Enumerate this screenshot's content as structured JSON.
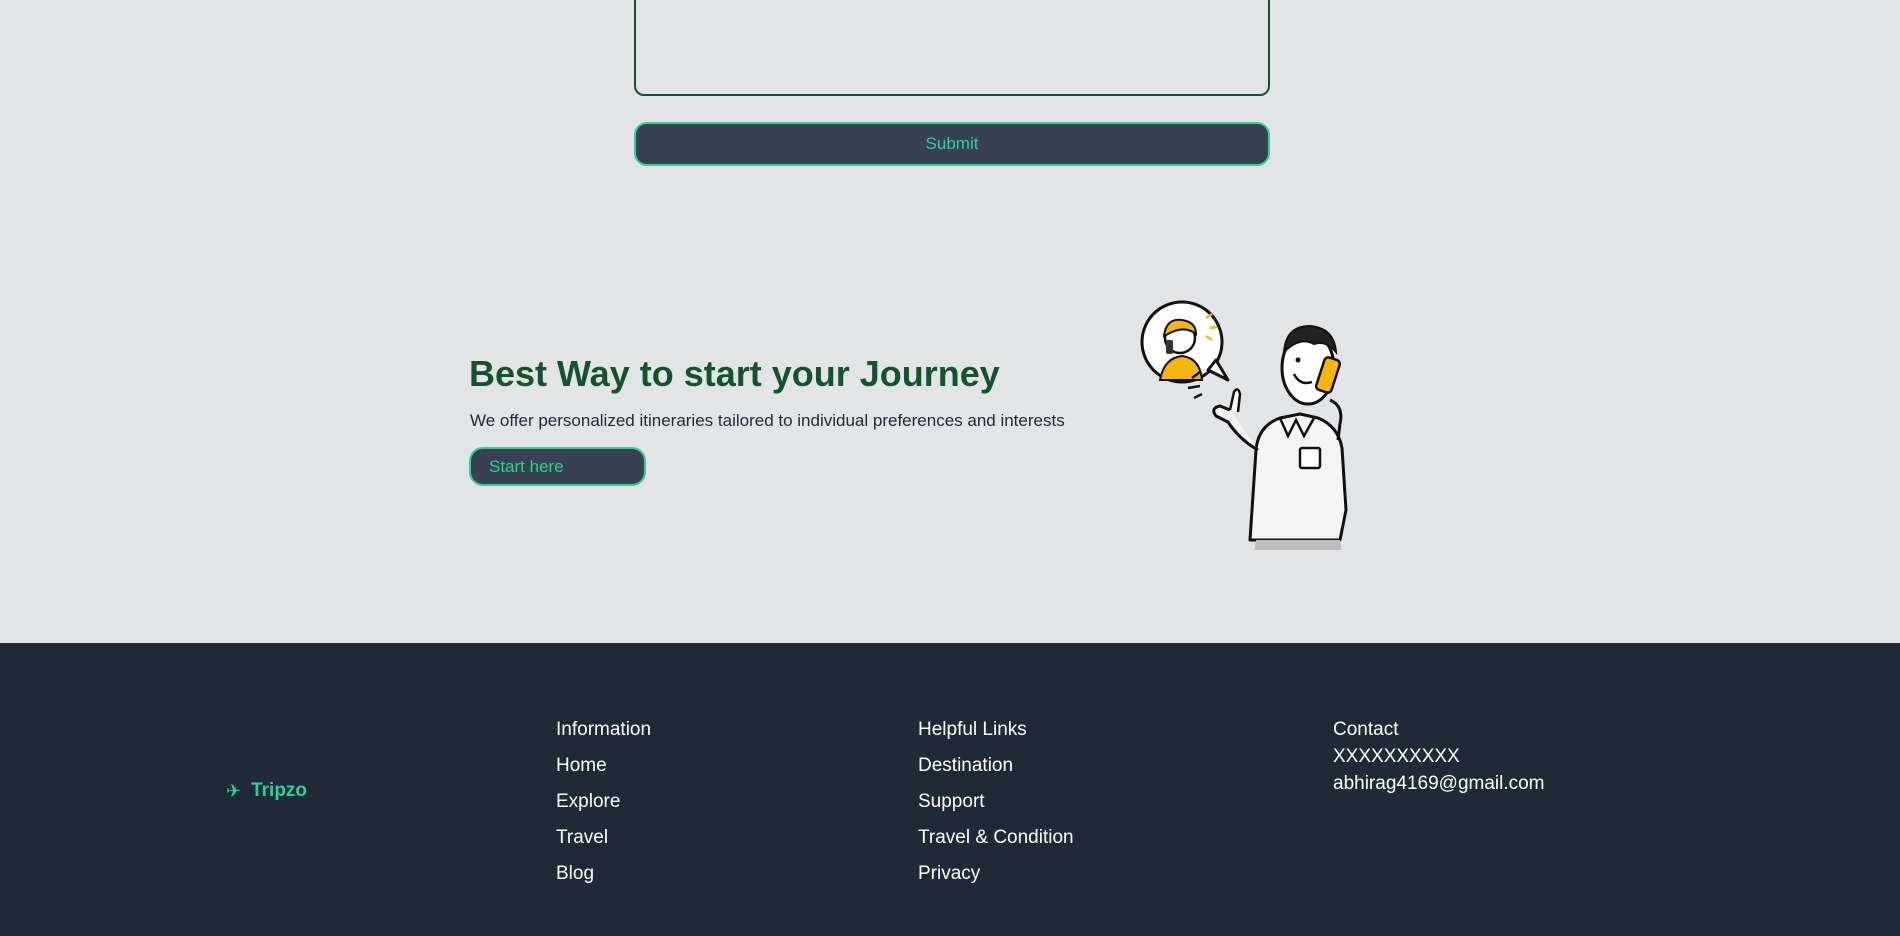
{
  "form": {
    "submit_label": "Submit"
  },
  "cta": {
    "title": "Best Way to start your Journey",
    "subtitle": "We offer personalized itineraries tailored to individual preferences and interests",
    "button_label": "Start here"
  },
  "footer": {
    "brand": "Tripzo",
    "brand_icon": "plane-icon",
    "information": {
      "heading": "Information",
      "links": [
        "Home",
        "Explore",
        "Travel",
        "Blog"
      ]
    },
    "helpful": {
      "heading": "Helpful Links",
      "links": [
        "Destination",
        "Support",
        "Travel & Condition",
        "Privacy"
      ]
    },
    "contact": {
      "heading": "Contact",
      "phone": "XXXXXXXXXX",
      "email": "abhirag4169@gmail.com"
    }
  },
  "colors": {
    "accent": "#2fd198",
    "heading": "#14532d",
    "footer_bg": "#1f2937",
    "page_bg": "#e3e4e6",
    "button_bg": "#374151"
  }
}
